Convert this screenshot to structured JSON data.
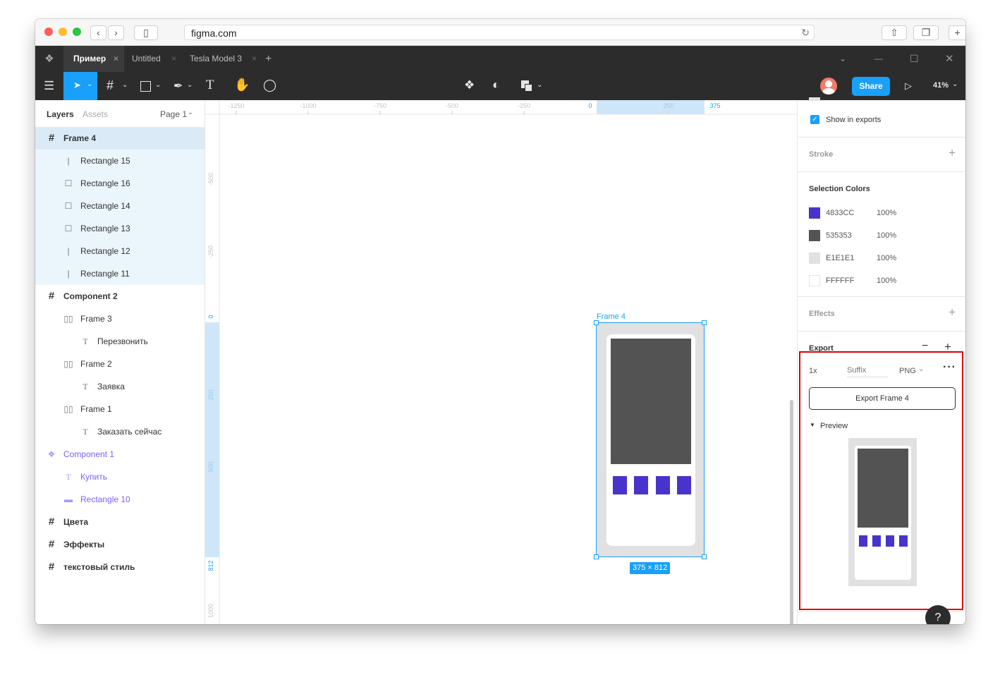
{
  "browser": {
    "url": "figma.com"
  },
  "tabs": [
    {
      "label": "Пример"
    },
    {
      "label": "Untitled"
    },
    {
      "label": "Tesla Model 3"
    }
  ],
  "toolbar": {
    "share_label": "Share",
    "zoom": "41%"
  },
  "left_panel": {
    "tab_layers": "Layers",
    "tab_assets": "Assets",
    "page": "Page 1",
    "layers": [
      {
        "label": "Frame 4",
        "icon": "frame-icon"
      },
      {
        "label": "Rectangle 15",
        "icon": "line-icon"
      },
      {
        "label": "Rectangle 16",
        "icon": "rectangle-icon"
      },
      {
        "label": "Rectangle 14",
        "icon": "rectangle-icon"
      },
      {
        "label": "Rectangle 13",
        "icon": "rectangle-icon"
      },
      {
        "label": "Rectangle 12",
        "icon": "line-icon"
      },
      {
        "label": "Rectangle 11",
        "icon": "line-icon"
      },
      {
        "label": "Component 2",
        "icon": "frame-icon"
      },
      {
        "label": "Frame 3",
        "icon": "auto-layout-icon"
      },
      {
        "label": "Перезвонить",
        "icon": "text-icon"
      },
      {
        "label": "Frame 2",
        "icon": "auto-layout-icon"
      },
      {
        "label": "Заявка",
        "icon": "text-icon"
      },
      {
        "label": "Frame 1",
        "icon": "auto-layout-icon"
      },
      {
        "label": "Заказать сейчас",
        "icon": "text-icon"
      },
      {
        "label": "Component 1",
        "icon": "component-icon"
      },
      {
        "label": "Купить",
        "icon": "text-icon"
      },
      {
        "label": "Rectangle 10",
        "icon": "rectangle-icon"
      },
      {
        "label": "Цвета",
        "icon": "frame-icon"
      },
      {
        "label": "Эффекты",
        "icon": "frame-icon"
      },
      {
        "label": "текстовый стиль",
        "icon": "frame-icon"
      }
    ]
  },
  "rulers": {
    "top": [
      "-1250",
      "-1000",
      "-750",
      "-500",
      "-250",
      "0",
      "250",
      "375"
    ],
    "left": [
      "-500",
      "-250",
      "0",
      "250",
      "500",
      "812",
      "1000"
    ]
  },
  "canvas": {
    "frame_label": "Frame 4",
    "size_badge": "375 × 812"
  },
  "right_panel": {
    "show_in_exports": "Show in exports",
    "stroke": "Stroke",
    "selection_colors": "Selection Colors",
    "colors": [
      {
        "hex": "4833CC",
        "opacity": "100%",
        "color": "#4833CC"
      },
      {
        "hex": "535353",
        "opacity": "100%",
        "color": "#535353"
      },
      {
        "hex": "E1E1E1",
        "opacity": "100%",
        "color": "#E1E1E1"
      },
      {
        "hex": "FFFFFF",
        "opacity": "100%",
        "color": "#FFFFFF"
      }
    ],
    "effects": "Effects",
    "export": {
      "title": "Export",
      "scale": "1x",
      "suffix_placeholder": "Suffix",
      "format": "PNG",
      "button": "Export Frame 4",
      "preview": "Preview"
    },
    "help": "?"
  }
}
